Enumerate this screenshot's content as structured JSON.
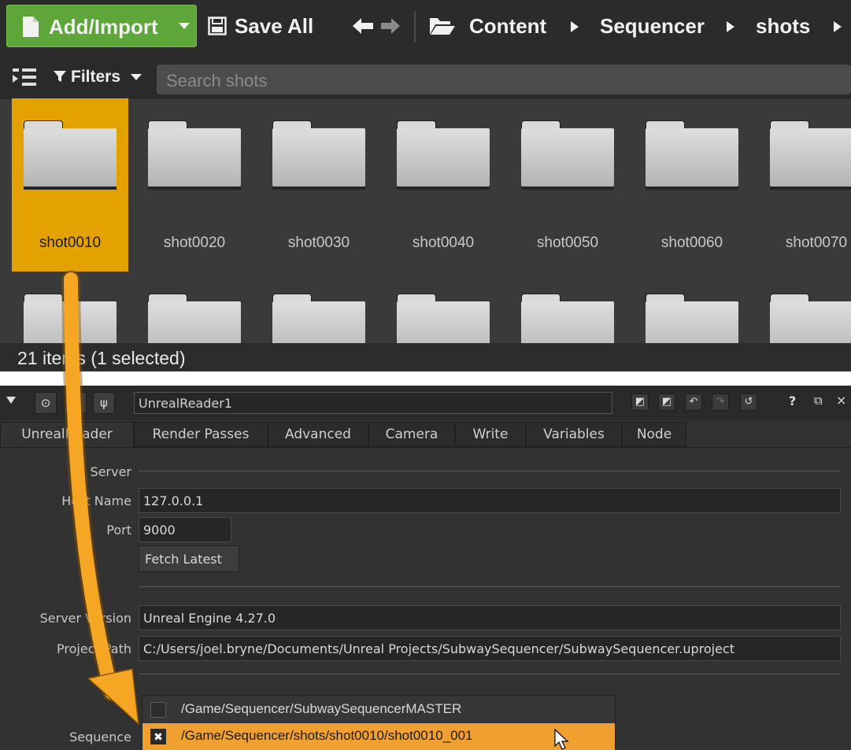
{
  "toolbar": {
    "add_import_label": "Add/Import",
    "save_all_label": "Save All",
    "breadcrumb": [
      "Content",
      "Sequencer",
      "shots"
    ]
  },
  "filters": {
    "label": "Filters",
    "search_placeholder": "Search shots"
  },
  "content_browser": {
    "folders_row1": [
      "shot0010",
      "shot0020",
      "shot0030",
      "shot0040",
      "shot0050",
      "shot0060",
      "shot0070"
    ],
    "selected_folder": "shot0010",
    "status": "21 items (1 selected)"
  },
  "panel": {
    "node_name": "UnrealReader1",
    "tabs": [
      "UnrealReader",
      "Render Passes",
      "Advanced",
      "Camera",
      "Write",
      "Variables",
      "Node"
    ],
    "active_tab": "UnrealReader",
    "server_section": "Server",
    "host_name_label": "Host Name",
    "host_name_value": "127.0.0.1",
    "port_label": "Port",
    "port_value": "9000",
    "fetch_latest_label": "Fetch Latest",
    "server_version_label": "Server Version",
    "server_version_value": "Unreal Engine 4.27.0",
    "project_path_label": "Project Path",
    "project_path_value": "C:/Users/joel.bryne/Documents/Unreal Projects/SubwaySequencer/SubwaySequencer.uproject",
    "sequence_label": "Sequence",
    "sequence_options": [
      {
        "path": "/Game/Sequencer/SubwaySequencerMASTER",
        "checked": false
      },
      {
        "path": "/Game/Sequencer/shots/shot0010/shot0010_001",
        "checked": true
      }
    ]
  },
  "colors": {
    "accent_green": "#5ea53a",
    "selection_orange": "#e4a200",
    "arrow_orange": "#f5a623"
  }
}
